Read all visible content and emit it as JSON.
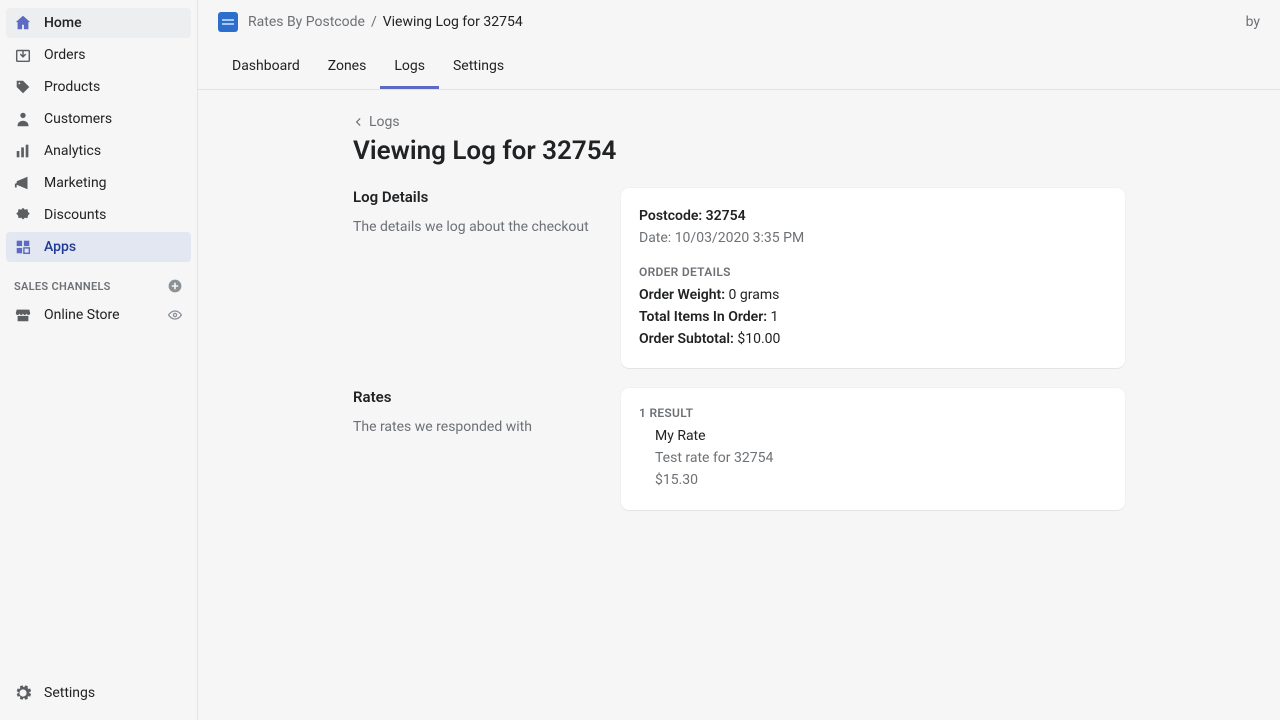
{
  "sidebar": {
    "items": [
      {
        "label": "Home"
      },
      {
        "label": "Orders"
      },
      {
        "label": "Products"
      },
      {
        "label": "Customers"
      },
      {
        "label": "Analytics"
      },
      {
        "label": "Marketing"
      },
      {
        "label": "Discounts"
      },
      {
        "label": "Apps"
      }
    ],
    "section_title": "SALES CHANNELS",
    "channels": [
      {
        "label": "Online Store"
      }
    ],
    "settings_label": "Settings"
  },
  "topbar": {
    "app_name": "Rates By Postcode",
    "sep": "/",
    "page": "Viewing Log for 32754",
    "right": "by"
  },
  "tabs": [
    {
      "label": "Dashboard"
    },
    {
      "label": "Zones"
    },
    {
      "label": "Logs"
    },
    {
      "label": "Settings"
    }
  ],
  "backlink": "Logs",
  "page_title": "Viewing Log for 32754",
  "log_details": {
    "heading": "Log Details",
    "desc": "The details we log about the checkout",
    "postcode_label": "Postcode:",
    "postcode_value": "32754",
    "date_label": "Date:",
    "date_value": "10/03/2020 3:35 PM",
    "order_details_heading": "ORDER DETAILS",
    "weight_label": "Order Weight:",
    "weight_value": "0 grams",
    "items_label": "Total Items In Order:",
    "items_value": "1",
    "subtotal_label": "Order Subtotal:",
    "subtotal_value": "$10.00"
  },
  "rates": {
    "heading": "Rates",
    "desc": "The rates we responded with",
    "result_count": "1 RESULT",
    "items": [
      {
        "name": "My Rate",
        "desc": "Test rate for 32754",
        "price": "$15.30"
      }
    ]
  }
}
